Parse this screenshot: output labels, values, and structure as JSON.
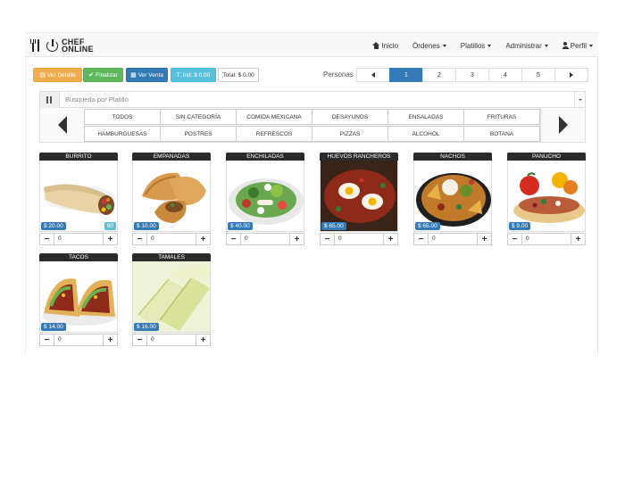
{
  "brand": {
    "line1": "CHEF",
    "line2": "ONLINE"
  },
  "nav": [
    {
      "label": "Inicio",
      "icon": "home-icon"
    },
    {
      "label": "Órdenes"
    },
    {
      "label": "Platillos"
    },
    {
      "label": "Administrar"
    },
    {
      "label": "Perfil",
      "icon": "user-icon"
    }
  ],
  "toolbar": {
    "ver_detalle": "Ver Detalle",
    "finalizar": "Finalizar",
    "ver_venta": "Ver Venta",
    "total_ind": "T. Ind: $ 0.00",
    "total": "Total: $ 0.00"
  },
  "personas": {
    "label": "Personas",
    "pages": [
      "1",
      "2",
      "3",
      "4",
      "5"
    ],
    "active": "1"
  },
  "search": {
    "placeholder": "Busqueda por Platillo"
  },
  "categories": [
    "TODOS",
    "SIN CATEGORÍA",
    "COMIDA MEXICANA",
    "DESAYUNOS",
    "ENSALADAS",
    "FRITURAS",
    "HAMBURGUESAS",
    "POSTRES",
    "REFRESCOS",
    "PIZZAS",
    "ALCOHOL",
    "BOTANA"
  ],
  "products": [
    {
      "name": "BURRITO",
      "price": "$ 20.00",
      "stock": "80",
      "qty": "0"
    },
    {
      "name": "EMPANADAS",
      "price": "$ 10.00",
      "qty": "0"
    },
    {
      "name": "ENCHILADAS",
      "price": "$ 40.00",
      "qty": "0"
    },
    {
      "name": "HUEVOS RANCHEROS",
      "price": "$ 65.00",
      "qty": "0"
    },
    {
      "name": "NACHOS",
      "price": "$ 65.00",
      "qty": "0"
    },
    {
      "name": "PANUCHO",
      "price": "$ 9.00",
      "qty": "0"
    },
    {
      "name": "TACOS",
      "price": "$ 14.00",
      "qty": "0"
    },
    {
      "name": "TAMALES",
      "price": "$ 16.00",
      "qty": "0"
    }
  ],
  "qty_controls": {
    "minus": "−",
    "plus": "+"
  },
  "colors": {
    "primary": "#337ab7",
    "warning": "#f0ad4e",
    "success": "#5cb85c",
    "info": "#5bc0de",
    "dark": "#2b2b2b"
  }
}
